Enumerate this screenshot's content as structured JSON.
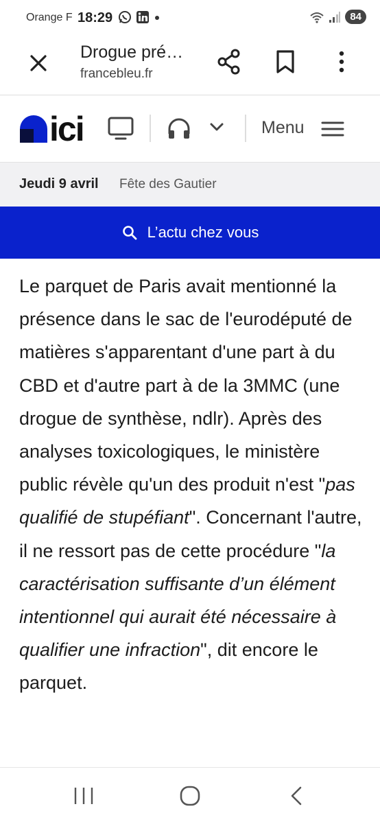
{
  "status_bar": {
    "carrier": "Orange F",
    "time": "18:29",
    "battery": "84"
  },
  "tab_bar": {
    "title": "Drogue pré…",
    "url": "francebleu.fr"
  },
  "site_header": {
    "logo_text": "ici",
    "menu_label": "Menu",
    "brand_color": "#0a22cc"
  },
  "date_bar": {
    "date": "Jeudi 9 avril",
    "saint": "Fête des Gautier"
  },
  "local_bar": {
    "label": "L’actu chez vous"
  },
  "article": {
    "part1": "Le parquet de Paris avait mentionné la présence dans le sac de l'eurodéputé de matières s'apparentant d'une part à du CBD et d'autre part à de la 3MMC (une drogue de synthèse, ndlr). Après des analyses toxicologiques, le ministère public révèle qu'un des produit n'est \"",
    "quote1": "pas qualifié de stupéfiant",
    "part2": "\". Concernant l'autre, il ne ressort pas de cette procédure \"",
    "quote2": "la caractérisation suffisante d’un élément intentionnel qui aurait été nécessaire à qualifier une infraction",
    "part3": "\", dit encore le parquet."
  }
}
